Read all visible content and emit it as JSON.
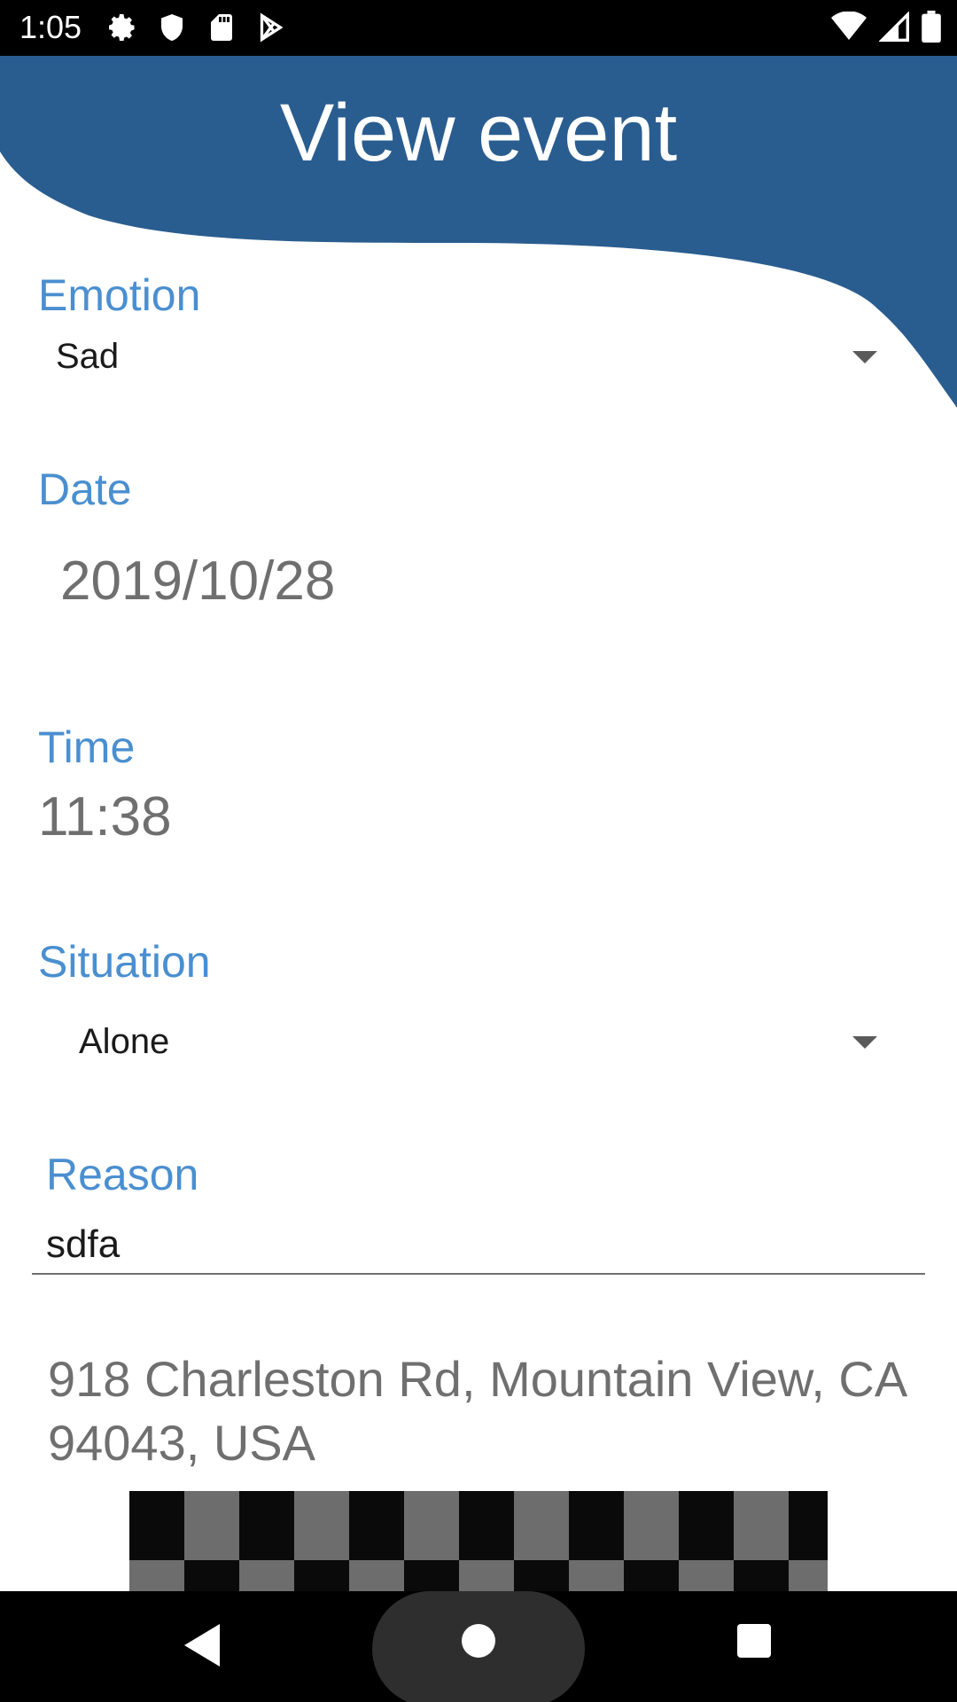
{
  "status_bar": {
    "time": "1:05",
    "left_icons": [
      "gear-icon",
      "shield-icon",
      "sd-card-icon",
      "play-store-icon"
    ],
    "right_icons": [
      "wifi-icon",
      "cell-signal-icon",
      "battery-icon"
    ]
  },
  "header": {
    "title": "View event",
    "color": "#2a5d8f"
  },
  "form": {
    "emotion": {
      "label": "Emotion",
      "value": "Sad"
    },
    "date": {
      "label": "Date",
      "value": "2019/10/28"
    },
    "time": {
      "label": "Time",
      "value": "11:38"
    },
    "situation": {
      "label": "Situation",
      "value": "Alone"
    },
    "reason": {
      "label": "Reason",
      "value": "sdfa"
    },
    "address": "918 Charleston Rd, Mountain View, CA 94043, USA"
  },
  "colors": {
    "label": "#4a8fd0",
    "value_gray": "#6f6f6f"
  },
  "nav_bar": {
    "buttons": [
      "back-icon",
      "home-icon",
      "recents-icon"
    ]
  }
}
